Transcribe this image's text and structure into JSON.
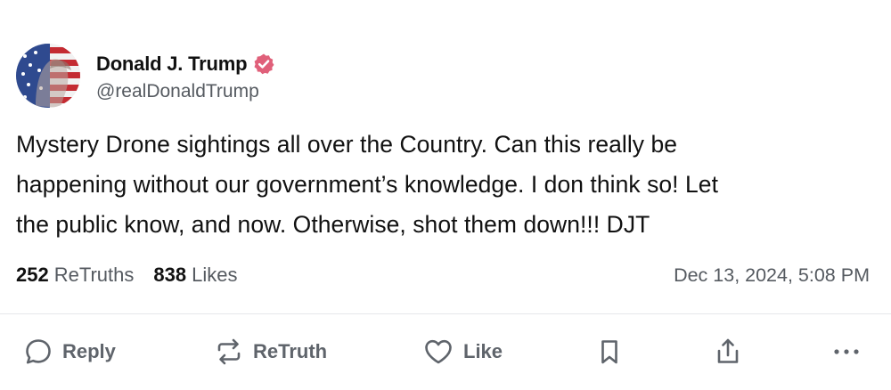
{
  "post": {
    "author": {
      "display_name": "Donald J. Trump",
      "handle": "@realDonaldTrump",
      "verified_icon": "verified-badge-icon",
      "verified_color": "#e0607a",
      "avatar": "flag-portrait-avatar"
    },
    "text": [
      "Mystery Drone sightings all over the Country. Can this really be",
      "happening without our government’s knowledge. I don think so! Let",
      "the public know, and now. Otherwise, shot them down!!! DJT"
    ],
    "stats": {
      "retruths_count": "252",
      "retruths_label": "ReTruths",
      "likes_count": "838",
      "likes_label": "Likes"
    },
    "timestamp": "Dec 13, 2024, 5:08 PM"
  },
  "actions": {
    "reply_label": "Reply",
    "retruth_label": "ReTruth",
    "like_label": "Like",
    "icons": [
      "reply-icon",
      "retruth-icon",
      "like-icon",
      "bookmark-icon",
      "share-icon",
      "more-icon"
    ],
    "icon_color": "#5f646b"
  }
}
